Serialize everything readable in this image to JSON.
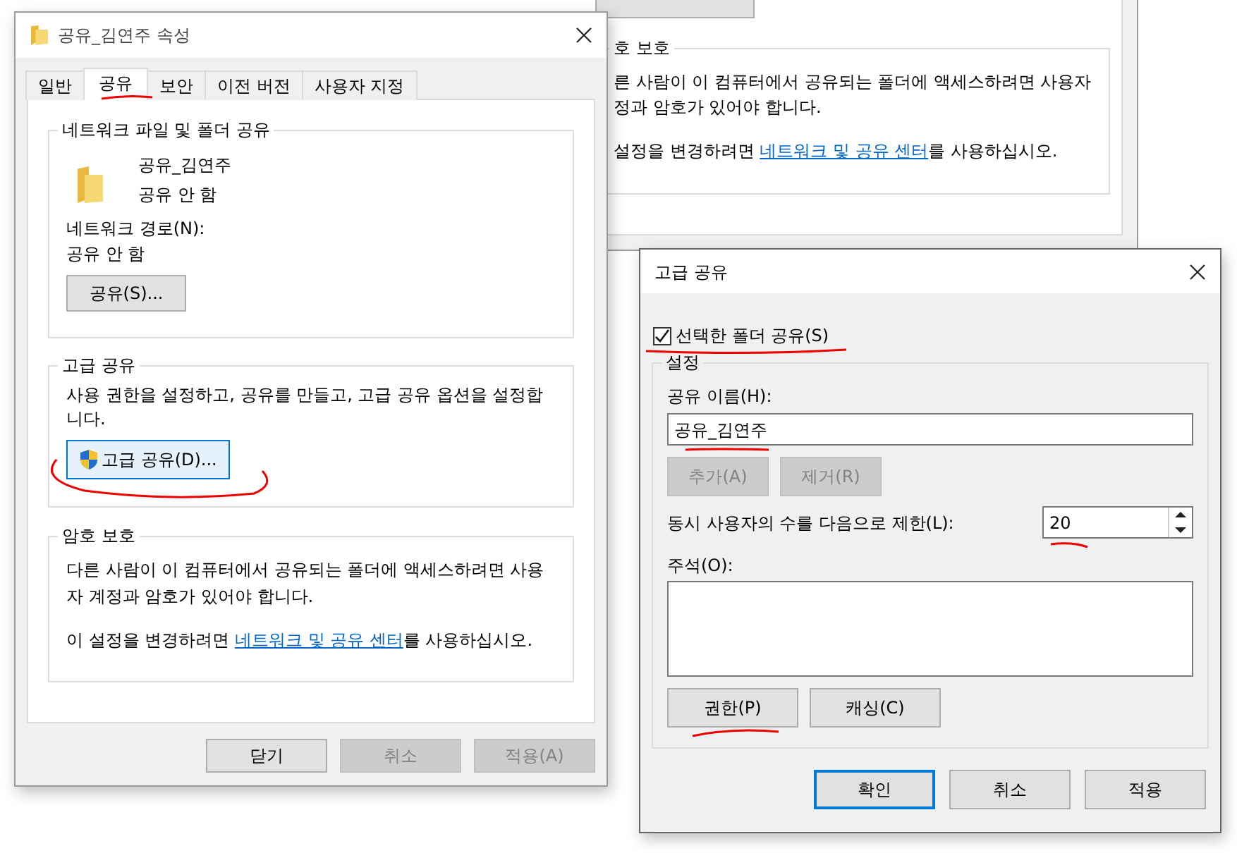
{
  "background_window": {
    "section_title": "호 보호",
    "lines": [
      "른 사람이 이 컴퓨터에서 공유되는 폴더에 액세스하려면 사용자",
      "정과 암호가 있어야 합니다."
    ],
    "change_prefix": "설정을 변경하려면 ",
    "link": "네트워크 및 공유 센터",
    "change_suffix": "를 사용하십시오."
  },
  "properties_window": {
    "title": "공유_김연주 속성",
    "tabs": [
      {
        "label": "일반",
        "selected": false
      },
      {
        "label": "공유",
        "selected": true
      },
      {
        "label": "보안",
        "selected": false
      },
      {
        "label": "이전 버전",
        "selected": false
      },
      {
        "label": "사용자 지정",
        "selected": false
      }
    ],
    "network_group": {
      "title": "네트워크 파일 및 폴더 공유",
      "folder_name": "공유_김연주",
      "share_status": "공유 안 함",
      "path_label": "네트워크 경로(N):",
      "path_value": "공유 안 함",
      "share_button": "공유(S)..."
    },
    "advanced_group": {
      "title": "고급 공유",
      "description": "사용 권한을 설정하고, 공유를 만들고, 고급 공유 옵션을 설정합니다.",
      "button": "고급 공유(D)..."
    },
    "password_group": {
      "title": "암호 보호",
      "description": "다른 사람이 이 컴퓨터에서 공유되는 폴더에 액세스하려면 사용자 계정과 암호가 있어야 합니다.",
      "change_prefix": "이 설정을 변경하려면 ",
      "link": "네트워크 및 공유 센터",
      "change_suffix": "를 사용하십시오."
    },
    "buttons": [
      {
        "label": "닫기",
        "disabled": false
      },
      {
        "label": "취소",
        "disabled": true
      },
      {
        "label": "적용(A)",
        "disabled": true
      }
    ]
  },
  "advanced_sharing_dialog": {
    "title": "고급 공유",
    "share_checkbox": {
      "label": "선택한 폴더 공유(S)",
      "checked": true
    },
    "settings_group": {
      "title": "설정",
      "share_name_label": "공유 이름(H):",
      "share_name": "공유_김연주",
      "name_buttons": [
        {
          "label": "추가(A)",
          "disabled": true
        },
        {
          "label": "제거(R)",
          "disabled": true
        }
      ],
      "limit_label": "동시 사용자의 수를 다음으로 제한(L):",
      "limit_value": "20",
      "comment_label": "주석(O):",
      "buttons": [
        {
          "label": "권한(P)",
          "disabled": false
        },
        {
          "label": "캐싱(C)",
          "disabled": false
        }
      ]
    },
    "buttons": [
      {
        "label": "확인",
        "default": true
      },
      {
        "label": "취소",
        "default": false
      },
      {
        "label": "적용",
        "default": false
      }
    ]
  }
}
